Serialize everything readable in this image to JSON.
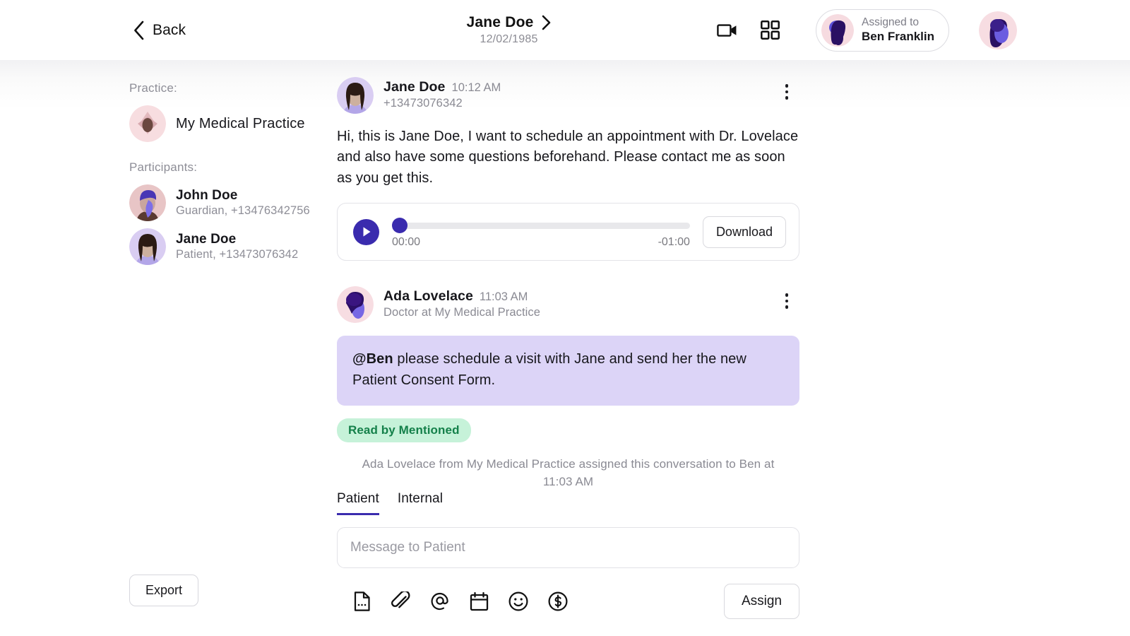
{
  "header": {
    "back_label": "Back",
    "patient_name": "Jane Doe",
    "patient_dob": "12/02/1985",
    "video_icon": "video-camera-icon",
    "grid_icon": "grid-apps-icon",
    "assigned_label": "Assigned to",
    "assigned_name": "Ben Franklin",
    "chevron_icon": "chevron-right-icon"
  },
  "sidebar": {
    "practice_label": "Practice:",
    "practice_name": "My Medical Practice",
    "participants_label": "Participants:",
    "participants": [
      {
        "name": "John Doe",
        "meta": "Guardian, +13476342756"
      },
      {
        "name": "Jane Doe",
        "meta": "Patient, +13473076342"
      }
    ],
    "export_label": "Export"
  },
  "thread": {
    "messages": [
      {
        "author": "Jane Doe",
        "time": "10:12 AM",
        "subtitle": "+13473076342",
        "body": "Hi, this is Jane Doe, I want to schedule an appointment with Dr. Lovelace and also have some questions beforehand. Please contact me as soon as you get this.",
        "audio": {
          "elapsed": "00:00",
          "remaining": "-01:00",
          "download_label": "Download",
          "progress_percent": 0,
          "play_icon": "play-icon"
        }
      },
      {
        "author": "Ada Lovelace",
        "time": "11:03 AM",
        "subtitle": "Doctor at My Medical Practice",
        "bubble_mention": "@Ben",
        "bubble_rest": " please schedule a visit with Jane and send her the new Patient Consent Form.",
        "read_badge": "Read by Mentioned"
      }
    ],
    "system_note": "Ada Lovelace from My Medical Practice assigned this conversation to Ben at 11:03 AM"
  },
  "composer": {
    "tabs": [
      {
        "label": "Patient",
        "active": true
      },
      {
        "label": "Internal",
        "active": false
      }
    ],
    "input_value": "",
    "input_placeholder": "Message to Patient",
    "tools": [
      "document-template-icon",
      "paperclip-attachment-icon",
      "at-mention-icon",
      "calendar-icon",
      "emoji-smiley-icon",
      "dollar-payment-icon"
    ],
    "assign_label": "Assign"
  },
  "colors": {
    "accent_indigo": "#3a2bae",
    "bubble_lavender": "#DCD4F7",
    "badge_green_bg": "#C6F2D9",
    "badge_green_text": "#14804a",
    "muted_text": "#8a8a93"
  }
}
